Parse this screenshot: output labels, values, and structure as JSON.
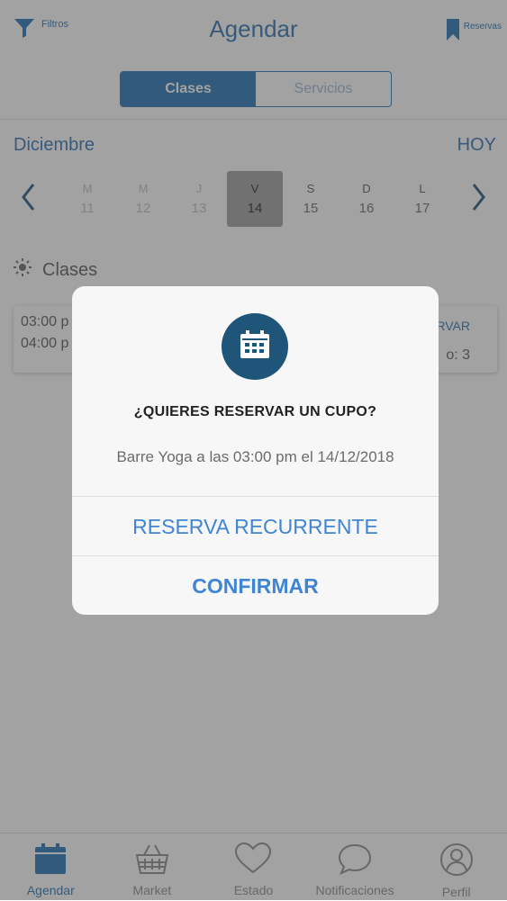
{
  "header": {
    "title": "Agendar",
    "filter_label": "Filtros",
    "reservas_label": "Reservas"
  },
  "segmented": {
    "active": "Clases",
    "inactive": "Servicios"
  },
  "calendar": {
    "month": "Diciembre",
    "today_label": "HOY",
    "days": [
      {
        "letter": "M",
        "num": "11"
      },
      {
        "letter": "M",
        "num": "12"
      },
      {
        "letter": "J",
        "num": "13"
      },
      {
        "letter": "V",
        "num": "14"
      },
      {
        "letter": "S",
        "num": "15"
      },
      {
        "letter": "D",
        "num": "16"
      },
      {
        "letter": "L",
        "num": "17"
      }
    ]
  },
  "section": {
    "label": "Clases"
  },
  "class_card": {
    "start": "03:00 p",
    "end": "04:00 p",
    "reservar": "RVAR",
    "cupos": "o: 3"
  },
  "modal": {
    "question": "¿QUIERES RESERVAR UN CUPO?",
    "detail": "Barre Yoga a las 03:00 pm el 14/12/2018",
    "recurring": "RESERVA RECURRENTE",
    "confirm": "CONFIRMAR"
  },
  "tabbar": {
    "items": [
      {
        "label": "Agendar"
      },
      {
        "label": "Market"
      },
      {
        "label": "Estado"
      },
      {
        "label": "Notificaciones"
      },
      {
        "label": "Perfil"
      }
    ]
  },
  "colors": {
    "primary": "#1f6fb2",
    "modal_badge": "#1e5578",
    "action_text": "#3f85d4"
  }
}
